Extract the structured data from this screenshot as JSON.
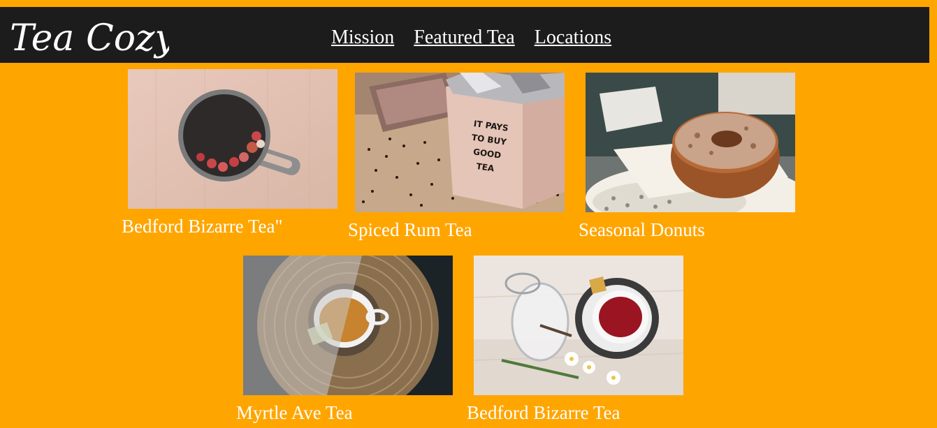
{
  "header": {
    "logo_text": "Tea Cozy",
    "nav": [
      {
        "label": "Mission"
      },
      {
        "label": "Featured Tea"
      },
      {
        "label": "Locations"
      }
    ]
  },
  "gallery": {
    "items": [
      {
        "caption": "Bedford Bizarre Tea\"",
        "image": "mug-of-tea-with-berries"
      },
      {
        "caption": "Spiced Rum Tea",
        "image": "box-of-loose-tea-it-pays-to-buy-good-tea"
      },
      {
        "caption": "Seasonal Donuts",
        "image": "sugared-donut-on-plate"
      },
      {
        "caption": "Myrtle Ave Tea",
        "image": "cup-of-tea-on-wooden-tray"
      },
      {
        "caption": "Bedford Bizarre Tea",
        "image": "cup-of-red-tea-with-sugar-jar"
      }
    ],
    "box_sign_text": [
      "IT PAYS",
      "TO BUY",
      "GOOD",
      "TEA"
    ]
  },
  "colors": {
    "page_background": "#ffa500",
    "header_background": "#1c1c1c",
    "text": "#ffffff"
  }
}
